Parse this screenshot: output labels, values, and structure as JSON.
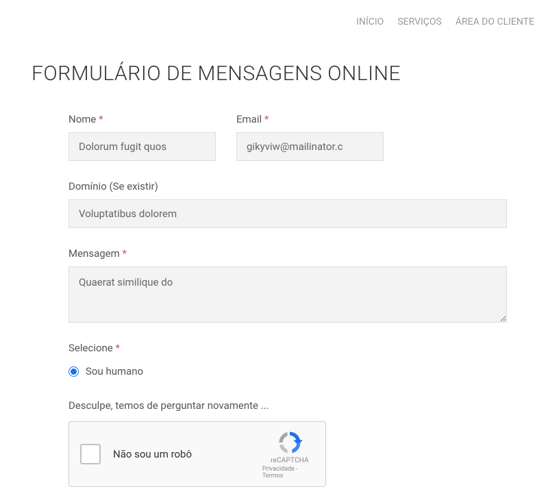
{
  "nav": {
    "home": "INÍCIO",
    "services": "SERVIÇOS",
    "client_area": "ÁREA DO CLIENTE"
  },
  "title": "FORMULÁRIO DE MENSAGENS ONLINE",
  "asterisk": "*",
  "form": {
    "name": {
      "label": "Nome",
      "value": "Dolorum fugit quos"
    },
    "email": {
      "label": "Email",
      "value": "gikyviw@mailinator.c"
    },
    "domain": {
      "label": "Domínio (Se existir)",
      "value": "Voluptatibus dolorem"
    },
    "message": {
      "label": "Mensagem",
      "value": "Quaerat similique do"
    },
    "select": {
      "label": "Selecione",
      "option_human": "Sou humano"
    },
    "recaptcha_intro": "Desculpe, temos de perguntar novamente ...",
    "recaptcha": {
      "text": "Não sou um robô",
      "brand": "reCAPTCHA",
      "links": "Privacidade - Termos"
    }
  }
}
